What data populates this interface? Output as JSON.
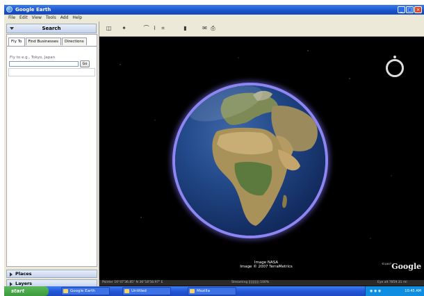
{
  "window": {
    "title": "Google Earth"
  },
  "menu": [
    "File",
    "Edit",
    "View",
    "Tools",
    "Add",
    "Help"
  ],
  "search_panel": {
    "header": "Search",
    "tabs": [
      "Fly To",
      "Find Businesses",
      "Directions"
    ],
    "fly_to_label": "Fly to e.g., Tokyo, Japan",
    "fly_to_value": "",
    "go_label": "Go"
  },
  "sections": {
    "places": "Places",
    "layers": "Layers"
  },
  "map": {
    "attribution_line1": "Image NASA",
    "attribution_line2": "Image © 2007 TerraMetrics",
    "logo": "Google",
    "logo_prefix": "©2007"
  },
  "status": {
    "pointer": "Pointer 16°47'36.85\" N 36°18'58.97\" E",
    "streaming": "Streaming |||||||||| 100%",
    "eye_alt": "Eye alt 7859.31 mi"
  },
  "taskbar": {
    "start": "start",
    "tasks": [
      "Google Earth",
      "Untitled",
      "Mozilla"
    ],
    "clock": "10:45 AM"
  },
  "colors": {
    "globe_glow": "#8d86f2",
    "titlebar": "#1c52c9",
    "taskbar": "#2458d9"
  }
}
